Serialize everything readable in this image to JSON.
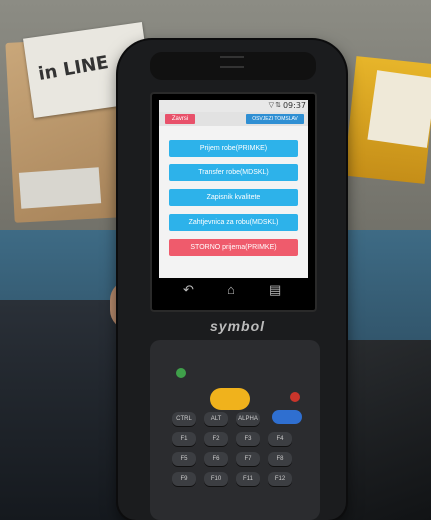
{
  "scene": {
    "box_label": "in LINE",
    "device_brand": "symbol"
  },
  "status_bar": {
    "time": "09:37",
    "wifi_icon": "wifi-icon",
    "signal_icon": "signal-icon"
  },
  "top_bar": {
    "close_label": "Zavrsi",
    "refresh_label": "OSVJEZI TOMSLAV"
  },
  "menu": {
    "items": [
      {
        "label": "Prijem robe(PRIMKE)",
        "color": "#2db2ea"
      },
      {
        "label": "Transfer robe(MDSKL)",
        "color": "#2db2ea"
      },
      {
        "label": "Zapisnik kvalitete",
        "color": "#2db2ea"
      },
      {
        "label": "Zahtjevnica za robu(MDSKL)",
        "color": "#2db2ea"
      },
      {
        "label": "STORNO prijema(PRIMKE)",
        "color": "#ef5b6c"
      }
    ]
  },
  "nav": {
    "back_icon": "back-icon",
    "home_icon": "home-icon",
    "recents_icon": "recents-icon"
  },
  "keypad": {
    "keys": [
      "CTRL",
      "ALT",
      "ALPHA",
      "",
      "F1",
      "F2",
      "F3",
      "F4",
      "F5",
      "F6",
      "F7",
      "F8",
      "F9",
      "F10",
      "F11",
      "F12"
    ]
  }
}
